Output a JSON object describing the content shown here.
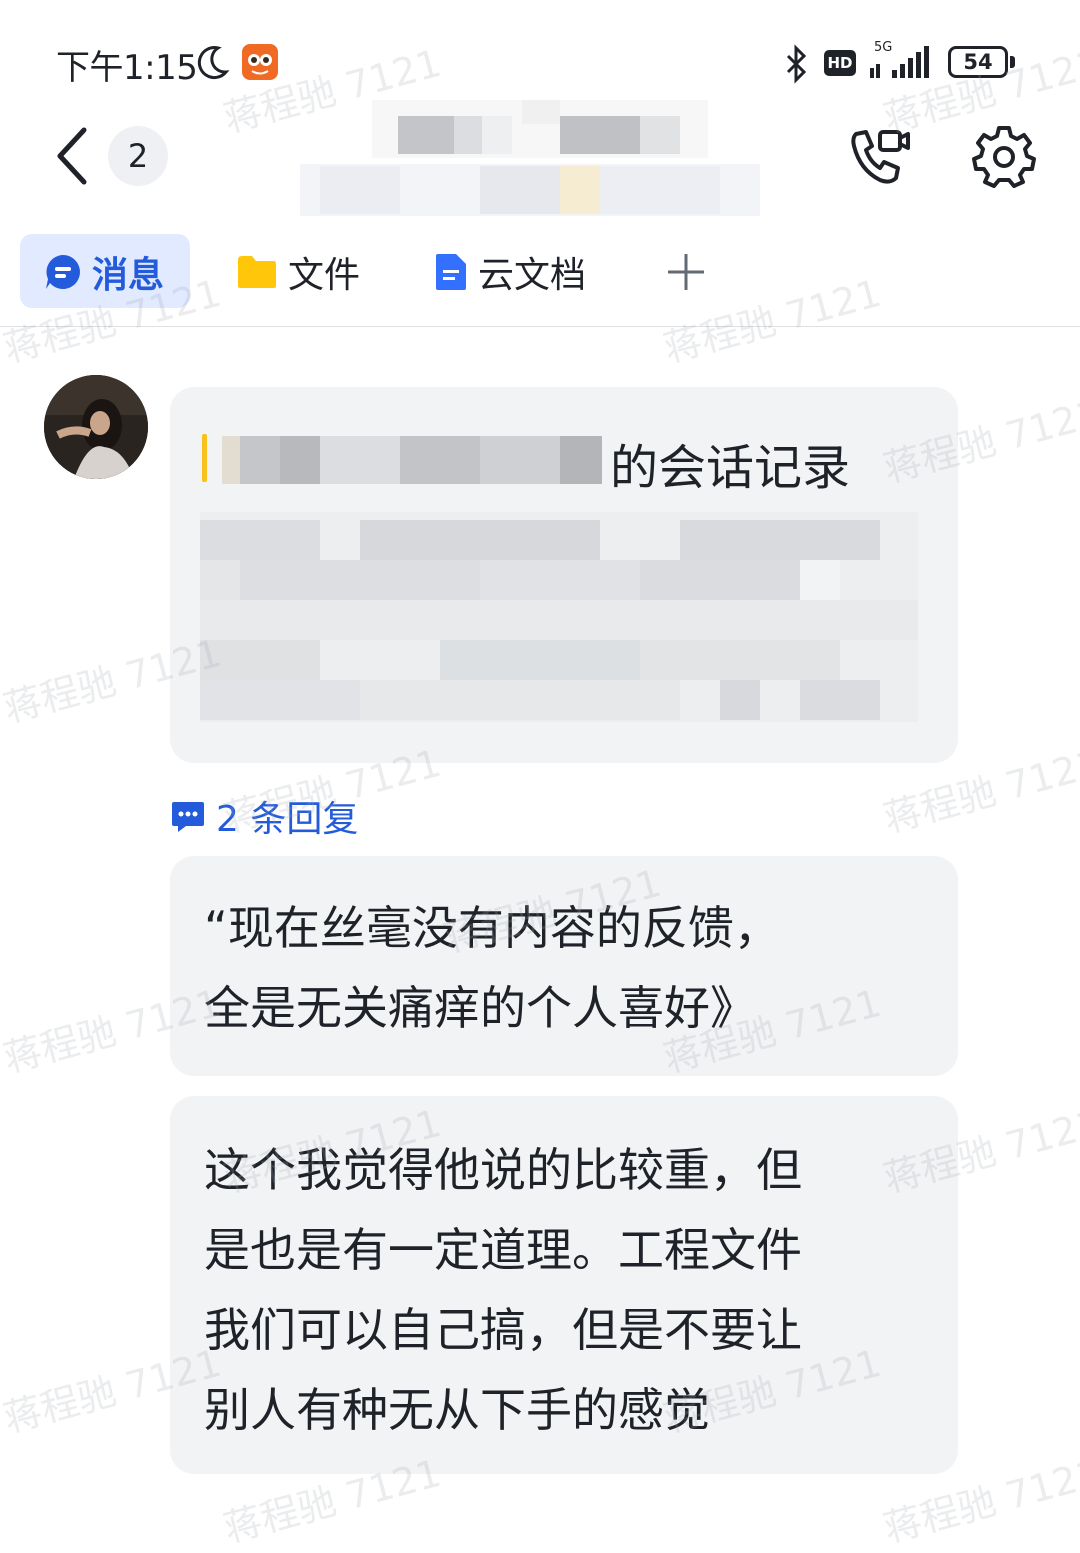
{
  "status_bar": {
    "time": "下午1:15",
    "network": "5G",
    "hd_label": "HD",
    "battery": "54"
  },
  "header": {
    "unread_count": "2"
  },
  "tabs": [
    {
      "label": "消息",
      "icon": "chat-bubble-icon",
      "active": true
    },
    {
      "label": "文件",
      "icon": "folder-icon",
      "active": false
    },
    {
      "label": "云文档",
      "icon": "document-icon",
      "active": false
    }
  ],
  "messages": {
    "forwarded_record": {
      "title_suffix": "的会话记录"
    },
    "reply_count": "2 条回复",
    "quote": {
      "lines": [
        "“现在丝毫没有内容的反馈，",
        "全是无关痛痒的个人喜好》"
      ]
    },
    "reply": {
      "lines": [
        "这个我觉得他说的比较重，但",
        "是也是有一定道理。工程文件",
        "我们可以自己搞，但是不要让",
        "别人有种无从下手的感觉"
      ]
    }
  },
  "watermark": "蒋程驰 7121",
  "colors": {
    "accent": "#245bdb",
    "tab_active_bg": "#e1eaff",
    "bubble_bg": "#f2f3f5",
    "quote_bar": "#f8c21a",
    "folder": "#ffc60a",
    "doc": "#3370ff"
  }
}
